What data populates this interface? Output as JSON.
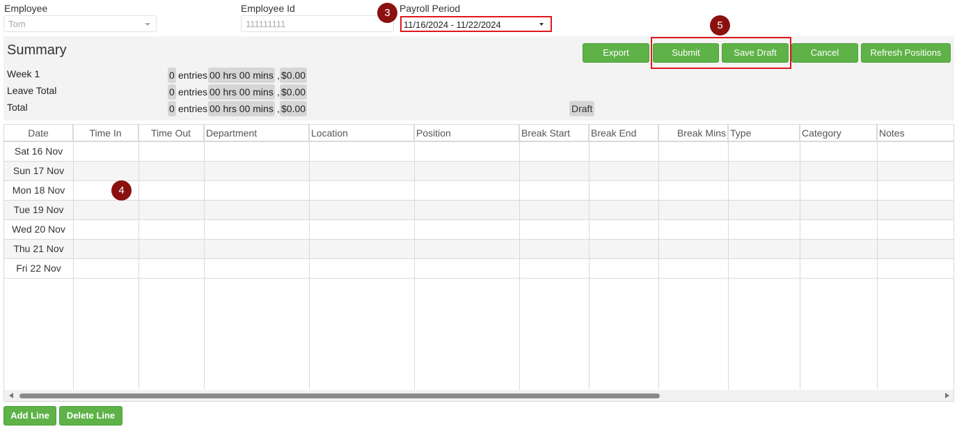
{
  "filters": {
    "employee_label": "Employee",
    "employee_value": "Tom",
    "employee_id_label": "Employee Id",
    "employee_id_value": "111111111",
    "payroll_period_label": "Payroll Period",
    "payroll_period_value": "11/16/2024 - 11/22/2024"
  },
  "markers": [
    "3",
    "4",
    "5"
  ],
  "summary": {
    "title": "Summary",
    "rows": [
      {
        "label": "Week 1",
        "entries": "0",
        "entries_unit": "entries",
        "hours": "00 hrs 00 mins",
        "sep": ",",
        "amount": "$0.00"
      },
      {
        "label": "Leave Total",
        "entries": "0",
        "entries_unit": "entries",
        "hours": "00 hrs 00 mins",
        "sep": ",",
        "amount": "$0.00"
      },
      {
        "label": "Total",
        "entries": "0",
        "entries_unit": "entries",
        "hours": "00 hrs 00 mins",
        "sep": ",",
        "amount": "$0.00"
      }
    ],
    "status": "Draft"
  },
  "toolbar": {
    "export": "Export",
    "submit": "Submit",
    "save_draft": "Save Draft",
    "cancel": "Cancel",
    "refresh_positions": "Refresh Positions"
  },
  "grid": {
    "columns": [
      "Date",
      "Time In",
      "Time Out",
      "Department",
      "Location",
      "Position",
      "Break Start",
      "Break End",
      "Break Mins",
      "Type",
      "Category",
      "Notes"
    ],
    "rows": [
      "Sat 16 Nov",
      "Sun 17 Nov",
      "Mon 18 Nov",
      "Tue 19 Nov",
      "Wed 20 Nov",
      "Thu 21 Nov",
      "Fri 22 Nov"
    ]
  },
  "footer": {
    "add_line": "Add Line",
    "delete_line": "Delete Line"
  },
  "colors": {
    "button_green": "#5eb247",
    "highlight_red": "#e2161c",
    "marker": "#8b1010"
  }
}
